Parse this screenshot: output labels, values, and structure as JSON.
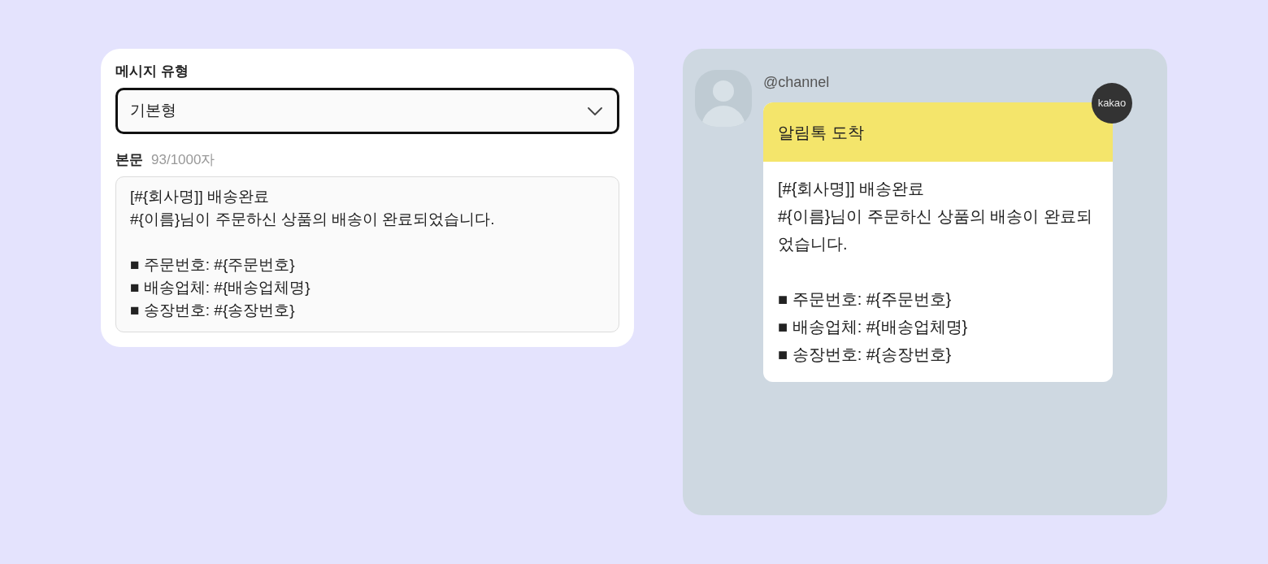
{
  "form": {
    "type_label": "메시지 유형",
    "type_select": {
      "value": "기본형"
    },
    "body_label": "본문",
    "char_count": "93/1000자",
    "body_field": {
      "value": "[#{회사명]] 배송완료\n#{이름}님이 주문하신 상품의 배송이 완료되었습니다.\n\n■ 주문번호: #{주문번호}\n■ 배송업체: #{배송업체명}\n■ 송장번호: #{송장번호}"
    }
  },
  "preview": {
    "channel_name": "@channel",
    "logo_badge": "kakao",
    "header": "알림톡 도착",
    "body": "[#{회사명]] 배송완료\n#{이름}님이 주문하신 상품의 배송이 완료되었습니다.\n\n■ 주문번호: #{주문번호}\n■ 배송업체: #{배송업체명}\n■ 송장번호: #{송장번호}"
  }
}
